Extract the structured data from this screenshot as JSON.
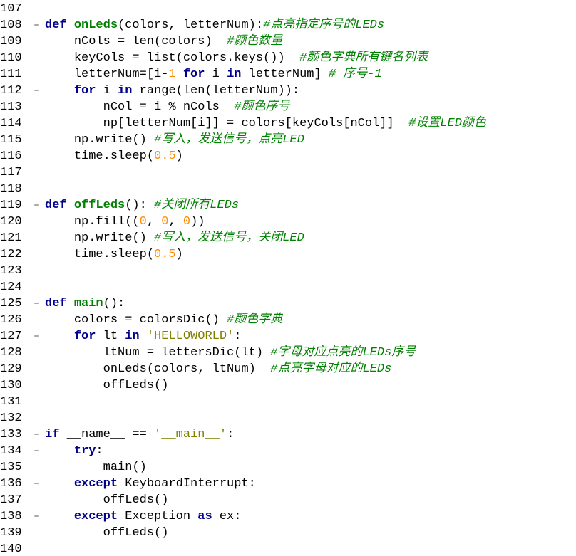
{
  "theme": {
    "keyword_color": "#00008b",
    "function_color": "#008000",
    "number_color": "#ff8c00",
    "string_color": "#808000",
    "comment_color": "#008000",
    "text_color": "#000000"
  },
  "lines": [
    {
      "n": "107",
      "fold": false,
      "indent": "",
      "tokens": []
    },
    {
      "n": "108",
      "fold": true,
      "indent": "",
      "tokens": [
        {
          "t": "kw",
          "v": "def "
        },
        {
          "t": "fn",
          "v": "onLeds"
        },
        {
          "t": "op",
          "v": "(colors, letterNum):"
        },
        {
          "t": "cm",
          "v": "#点亮指定序号的LEDs"
        }
      ]
    },
    {
      "n": "109",
      "fold": false,
      "indent": "    ",
      "tokens": [
        {
          "t": "op",
          "v": "nCols = len(colors)  "
        },
        {
          "t": "cm",
          "v": "#颜色数量"
        }
      ]
    },
    {
      "n": "110",
      "fold": false,
      "indent": "    ",
      "tokens": [
        {
          "t": "op",
          "v": "keyCols = list(colors.keys())  "
        },
        {
          "t": "cm",
          "v": "#颜色字典所有键名列表"
        }
      ]
    },
    {
      "n": "111",
      "fold": false,
      "indent": "    ",
      "tokens": [
        {
          "t": "op",
          "v": "letterNum=[i-"
        },
        {
          "t": "num",
          "v": "1"
        },
        {
          "t": "op",
          "v": " "
        },
        {
          "t": "kw",
          "v": "for"
        },
        {
          "t": "op",
          "v": " i "
        },
        {
          "t": "kw",
          "v": "in"
        },
        {
          "t": "op",
          "v": " letterNum] "
        },
        {
          "t": "cm",
          "v": "# 序号-1"
        }
      ]
    },
    {
      "n": "112",
      "fold": true,
      "indent": "    ",
      "tokens": [
        {
          "t": "kw",
          "v": "for"
        },
        {
          "t": "op",
          "v": " i "
        },
        {
          "t": "kw",
          "v": "in"
        },
        {
          "t": "op",
          "v": " range(len(letterNum)):"
        }
      ]
    },
    {
      "n": "113",
      "fold": false,
      "indent": "        ",
      "tokens": [
        {
          "t": "op",
          "v": "nCol = i % nCols  "
        },
        {
          "t": "cm",
          "v": "#颜色序号"
        }
      ]
    },
    {
      "n": "114",
      "fold": false,
      "indent": "        ",
      "tokens": [
        {
          "t": "op",
          "v": "np[letterNum[i]] = colors[keyCols[nCol]]  "
        },
        {
          "t": "cm",
          "v": "#设置LED颜色"
        }
      ]
    },
    {
      "n": "115",
      "fold": false,
      "indent": "    ",
      "tokens": [
        {
          "t": "op",
          "v": "np.write() "
        },
        {
          "t": "cm",
          "v": "#写入，发送信号，点亮LED"
        }
      ]
    },
    {
      "n": "116",
      "fold": false,
      "indent": "    ",
      "tokens": [
        {
          "t": "op",
          "v": "time.sleep("
        },
        {
          "t": "num",
          "v": "0.5"
        },
        {
          "t": "op",
          "v": ")"
        }
      ]
    },
    {
      "n": "117",
      "fold": false,
      "indent": "",
      "tokens": []
    },
    {
      "n": "118",
      "fold": false,
      "indent": "",
      "tokens": []
    },
    {
      "n": "119",
      "fold": true,
      "indent": "",
      "tokens": [
        {
          "t": "kw",
          "v": "def "
        },
        {
          "t": "fn",
          "v": "offLeds"
        },
        {
          "t": "op",
          "v": "(): "
        },
        {
          "t": "cm",
          "v": "#关闭所有LEDs"
        }
      ]
    },
    {
      "n": "120",
      "fold": false,
      "indent": "    ",
      "tokens": [
        {
          "t": "op",
          "v": "np.fill(("
        },
        {
          "t": "num",
          "v": "0"
        },
        {
          "t": "op",
          "v": ", "
        },
        {
          "t": "num",
          "v": "0"
        },
        {
          "t": "op",
          "v": ", "
        },
        {
          "t": "num",
          "v": "0"
        },
        {
          "t": "op",
          "v": "))"
        }
      ]
    },
    {
      "n": "121",
      "fold": false,
      "indent": "    ",
      "tokens": [
        {
          "t": "op",
          "v": "np.write() "
        },
        {
          "t": "cm",
          "v": "#写入，发送信号，关闭LED"
        }
      ]
    },
    {
      "n": "122",
      "fold": false,
      "indent": "    ",
      "tokens": [
        {
          "t": "op",
          "v": "time.sleep("
        },
        {
          "t": "num",
          "v": "0.5"
        },
        {
          "t": "op",
          "v": ")"
        }
      ]
    },
    {
      "n": "123",
      "fold": false,
      "indent": "",
      "tokens": []
    },
    {
      "n": "124",
      "fold": false,
      "indent": "",
      "tokens": []
    },
    {
      "n": "125",
      "fold": true,
      "indent": "",
      "tokens": [
        {
          "t": "kw",
          "v": "def "
        },
        {
          "t": "fn",
          "v": "main"
        },
        {
          "t": "op",
          "v": "():"
        }
      ]
    },
    {
      "n": "126",
      "fold": false,
      "indent": "    ",
      "tokens": [
        {
          "t": "op",
          "v": "colors = colorsDic() "
        },
        {
          "t": "cm",
          "v": "#颜色字典"
        }
      ]
    },
    {
      "n": "127",
      "fold": true,
      "indent": "    ",
      "tokens": [
        {
          "t": "kw",
          "v": "for"
        },
        {
          "t": "op",
          "v": " lt "
        },
        {
          "t": "kw",
          "v": "in"
        },
        {
          "t": "op",
          "v": " "
        },
        {
          "t": "str",
          "v": "'HELLOWORLD'"
        },
        {
          "t": "op",
          "v": ":"
        }
      ]
    },
    {
      "n": "128",
      "fold": false,
      "indent": "        ",
      "tokens": [
        {
          "t": "op",
          "v": "ltNum = lettersDic(lt) "
        },
        {
          "t": "cm",
          "v": "#字母对应点亮的LEDs序号"
        }
      ]
    },
    {
      "n": "129",
      "fold": false,
      "indent": "        ",
      "tokens": [
        {
          "t": "op",
          "v": "onLeds(colors, ltNum)  "
        },
        {
          "t": "cm",
          "v": "#点亮字母对应的LEDs"
        }
      ]
    },
    {
      "n": "130",
      "fold": false,
      "indent": "        ",
      "tokens": [
        {
          "t": "op",
          "v": "offLeds()"
        }
      ]
    },
    {
      "n": "131",
      "fold": false,
      "indent": "",
      "tokens": []
    },
    {
      "n": "132",
      "fold": false,
      "indent": "",
      "tokens": []
    },
    {
      "n": "133",
      "fold": true,
      "indent": "",
      "tokens": [
        {
          "t": "kw",
          "v": "if"
        },
        {
          "t": "op",
          "v": " __name__ == "
        },
        {
          "t": "str",
          "v": "'__main__'"
        },
        {
          "t": "op",
          "v": ":"
        }
      ]
    },
    {
      "n": "134",
      "fold": true,
      "indent": "    ",
      "tokens": [
        {
          "t": "kw",
          "v": "try"
        },
        {
          "t": "op",
          "v": ":"
        }
      ]
    },
    {
      "n": "135",
      "fold": false,
      "indent": "        ",
      "tokens": [
        {
          "t": "op",
          "v": "main()"
        }
      ]
    },
    {
      "n": "136",
      "fold": true,
      "indent": "    ",
      "tokens": [
        {
          "t": "kw",
          "v": "except"
        },
        {
          "t": "op",
          "v": " KeyboardInterrupt:"
        }
      ]
    },
    {
      "n": "137",
      "fold": false,
      "indent": "        ",
      "tokens": [
        {
          "t": "op",
          "v": "offLeds()"
        }
      ]
    },
    {
      "n": "138",
      "fold": true,
      "indent": "    ",
      "tokens": [
        {
          "t": "kw",
          "v": "except"
        },
        {
          "t": "op",
          "v": " Exception "
        },
        {
          "t": "kw",
          "v": "as"
        },
        {
          "t": "op",
          "v": " ex:"
        }
      ]
    },
    {
      "n": "139",
      "fold": false,
      "indent": "        ",
      "tokens": [
        {
          "t": "op",
          "v": "offLeds()"
        }
      ]
    },
    {
      "n": "140",
      "fold": false,
      "indent": "",
      "tokens": []
    }
  ],
  "fold_marker": "–"
}
